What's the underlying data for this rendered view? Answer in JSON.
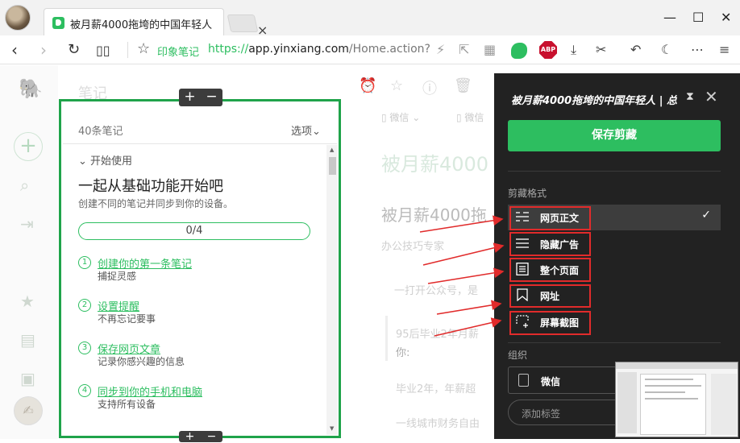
{
  "browser": {
    "tab_title": "被月薪4000拖垮的中国年轻人",
    "tab_close": "×",
    "window_controls": {
      "minimize": "—",
      "maximize": "☐",
      "close": "✕"
    },
    "brand_label": "印象笔记",
    "url_proto": "https://",
    "url_host": "app.yinxiang.com",
    "url_path": "/Home.action?",
    "abp_label": "ABP"
  },
  "notes": {
    "bg_title": "笔记",
    "count": "40条笔记",
    "options_label": "选项",
    "section_header": "开始使用",
    "section_title": "一起从基础功能开始吧",
    "section_subtitle": "创建不同的笔记并同步到你的设备。",
    "progress_text": "0/4",
    "progress_fraction": 0,
    "steps": [
      {
        "num": "1",
        "title": "创建你的第一条笔记",
        "sub": "捕捉灵感"
      },
      {
        "num": "2",
        "title": "设置提醒",
        "sub": "不再忘记要事"
      },
      {
        "num": "3",
        "title": "保存网页文章",
        "sub": "记录你感兴趣的信息"
      },
      {
        "num": "4",
        "title": "同步到你的手机和电脑",
        "sub": "支持所有设备"
      }
    ]
  },
  "note_view": {
    "meta_notebook": "微信",
    "meta_other": "微信",
    "heading_large": "被月薪4000",
    "heading_medium": "被月薪4000拖",
    "author": "办公技巧专家",
    "para1": "一打开公众号，是",
    "quote1": "95后毕业2年月薪",
    "quote2": "你:",
    "para2": "毕业2年，年薪超",
    "para3": "一线城市财务自由"
  },
  "clipper": {
    "title": "被月薪4000拖垮的中国年轻人 | 总",
    "save_button": "保存剪藏",
    "format_label": "剪藏格式",
    "formats": [
      {
        "label": "网页正文",
        "icon": "article-icon",
        "selected": true
      },
      {
        "label": "隐藏广告",
        "icon": "simplified-icon",
        "selected": false
      },
      {
        "label": "整个页面",
        "icon": "full-page-icon",
        "selected": false
      },
      {
        "label": "网址",
        "icon": "bookmark-icon",
        "selected": false
      },
      {
        "label": "屏幕截图",
        "icon": "screenshot-icon",
        "selected": false
      }
    ],
    "checkmark": "✓",
    "org_label": "组织",
    "notebook": "微信",
    "tag_placeholder": "添加标签"
  },
  "colors": {
    "accent": "#2dbe60",
    "highlight": "#e12b2b",
    "frame": "#1fa34a",
    "panel": "#222222"
  }
}
